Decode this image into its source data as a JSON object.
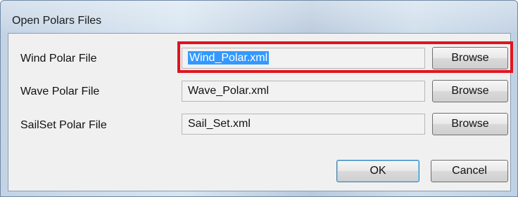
{
  "window": {
    "title": "Open Polars Files"
  },
  "rows": [
    {
      "label": "Wind Polar File",
      "value": "Wind_Polar.xml",
      "selected": true,
      "button": "Browse"
    },
    {
      "label": "Wave Polar File",
      "value": "Wave_Polar.xml",
      "selected": false,
      "button": "Browse"
    },
    {
      "label": "SailSet Polar File",
      "value": "Sail_Set.xml",
      "selected": false,
      "button": "Browse"
    }
  ],
  "actions": {
    "ok_label": "OK",
    "cancel_label": "Cancel"
  },
  "colors": {
    "highlight": "#e1141f",
    "selection": "#3399ff"
  }
}
